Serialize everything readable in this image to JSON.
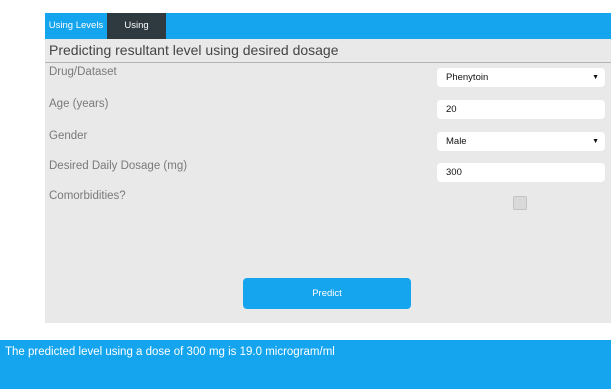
{
  "tabs": [
    {
      "label": "Using Levels",
      "active": false
    },
    {
      "label": "Using Dosage",
      "active": true
    }
  ],
  "panel": {
    "title": "Predicting resultant level using desired dosage"
  },
  "form": {
    "drug": {
      "label": "Drug/Dataset",
      "value": "Phenytoin"
    },
    "age": {
      "label": "Age (years)",
      "value": "20"
    },
    "gender": {
      "label": "Gender",
      "value": "Male"
    },
    "dosage": {
      "label": "Desired Daily Dosage (mg)",
      "value": "300"
    },
    "comorbidities": {
      "label": "Comorbidities?",
      "checked": false
    }
  },
  "predict_button": {
    "label": "Predict"
  },
  "result": {
    "text": "The predicted level using a dose of 300 mg is 19.0 microgram/ml"
  },
  "colors": {
    "accent": "#15a5ee",
    "active_tab": "#2f3a40",
    "panel_bg": "#e9e9e9"
  },
  "icons": {
    "select_arrow": "dropdown-arrow-icon"
  }
}
